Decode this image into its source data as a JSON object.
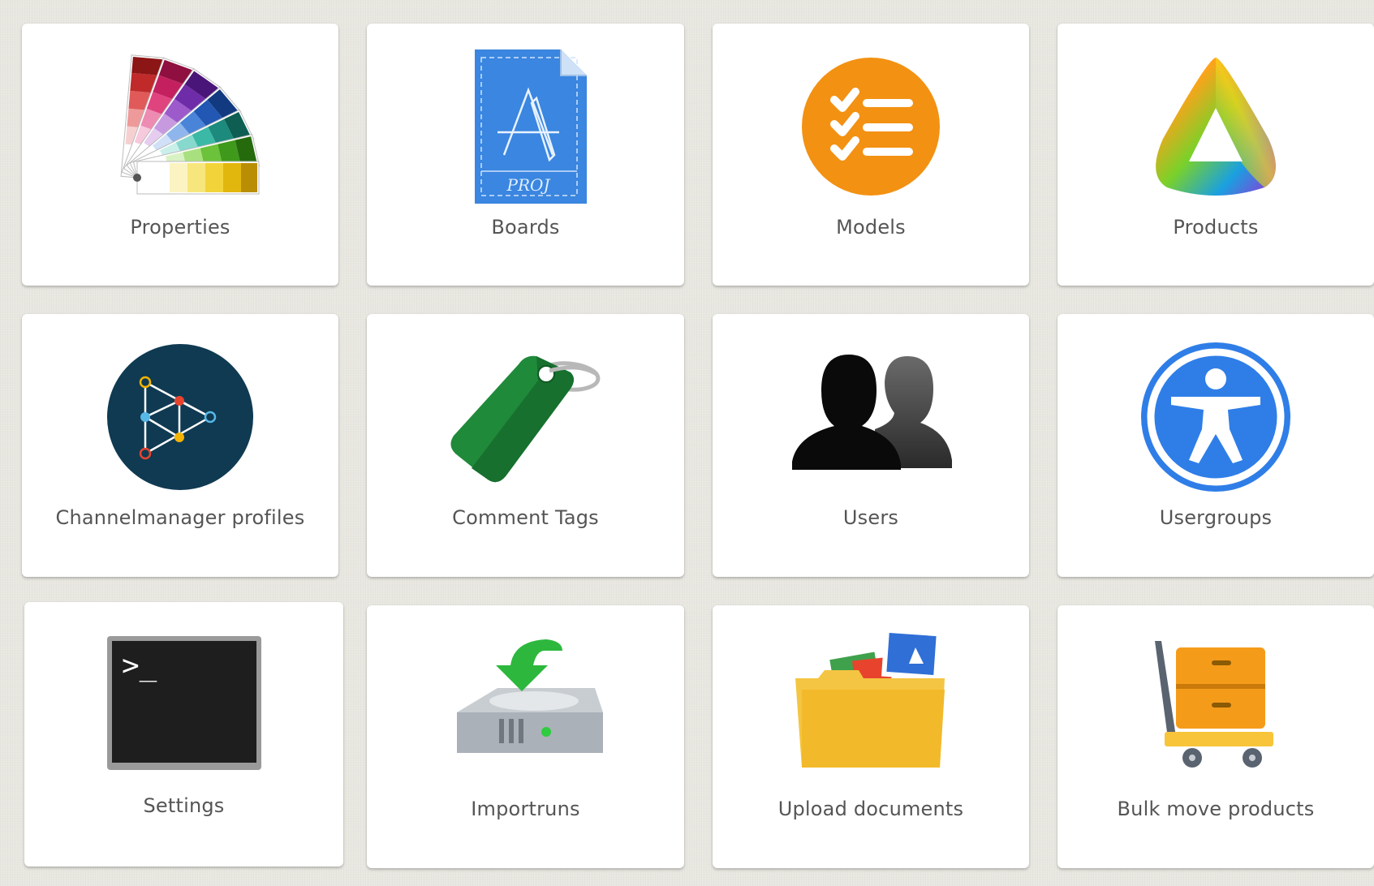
{
  "tiles": [
    {
      "label": "Properties",
      "icon": "color-swatch-fan-icon"
    },
    {
      "label": "Boards",
      "icon": "blueprint-document-icon"
    },
    {
      "label": "Models",
      "icon": "checklist-circle-icon"
    },
    {
      "label": "Products",
      "icon": "rainbow-triangle-icon"
    },
    {
      "label": "Channelmanager profiles",
      "icon": "network-graph-circle-icon"
    },
    {
      "label": "Comment Tags",
      "icon": "green-tag-icon"
    },
    {
      "label": "Users",
      "icon": "users-silhouette-icon"
    },
    {
      "label": "Usergroups",
      "icon": "accessibility-person-icon"
    },
    {
      "label": "Settings",
      "icon": "terminal-icon",
      "terminal_prompt": ">_"
    },
    {
      "label": "Importruns",
      "icon": "hard-drive-download-icon"
    },
    {
      "label": "Upload documents",
      "icon": "folder-documents-icon"
    },
    {
      "label": "Bulk move products",
      "icon": "hand-truck-boxes-icon"
    }
  ],
  "colors": {
    "background": "#e8e7e0",
    "tile": "#ffffff",
    "label": "#555555",
    "models_orange": "#f39112",
    "channel_navy": "#0f3a52",
    "usergroups_blue": "#2f7ee8",
    "tag_green": "#1f8a3a",
    "folder_yellow": "#f4c542",
    "cart_orange": "#f59b1a"
  }
}
